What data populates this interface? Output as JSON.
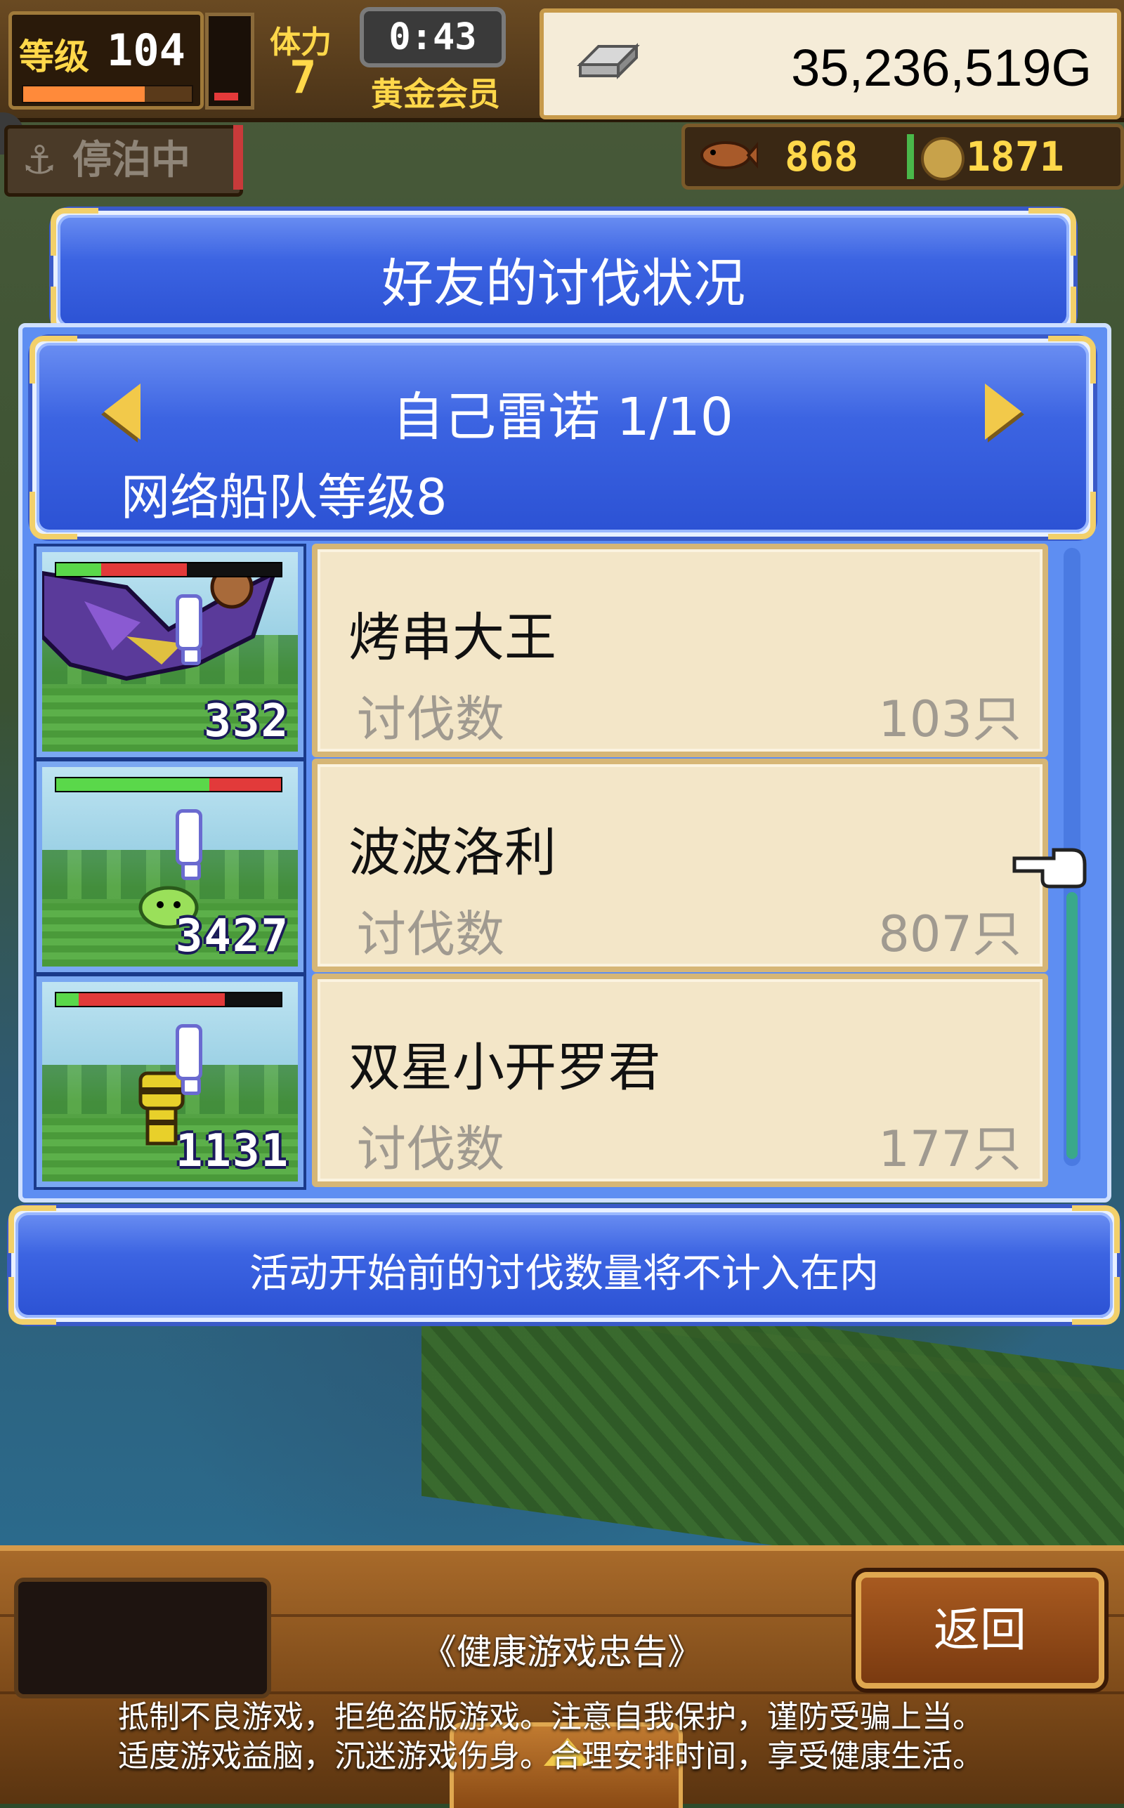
{
  "hud": {
    "level_label": "等级",
    "level_value": "104",
    "level_progress": 0.72,
    "stamina_gauge": 0.1,
    "stamina_label": "体力",
    "stamina_value": "7",
    "timer": "0:43",
    "membership": "黄金会员",
    "money": "35,236,519G",
    "dock_status": "停泊中",
    "resource1": "868",
    "resource2": "1871"
  },
  "dialog": {
    "title": "好友的讨伐状况",
    "page_name": "自己雷诺 1/10",
    "fleet_level": "网络船队等级8",
    "notice": "活动开始前的讨伐数量将不计入在内"
  },
  "list": {
    "kill_label": "讨伐数",
    "rows": [
      {
        "name": "烤串大王",
        "count_value": "103只",
        "thumb_count": "332",
        "hp_green": 0.2,
        "hp_red": 0.38
      },
      {
        "name": "波波洛利",
        "count_value": "807只",
        "thumb_count": "3427",
        "hp_green": 0.68,
        "hp_red": 0.32
      },
      {
        "name": "双星小开罗君",
        "count_value": "177只",
        "thumb_count": "1131",
        "hp_green": 0.1,
        "hp_red": 0.65
      }
    ]
  },
  "footer": {
    "back_button": "返回",
    "health_title": "《健康游戏忠告》",
    "health_line1": "抵制不良游戏，拒绝盗版游戏。注意自我保护，谨防受骗上当。",
    "health_line2": "适度游戏益脑，沉迷游戏伤身。合理安排时间，享受健康生活。"
  },
  "colors": {
    "panel_blue": "#3c64e2",
    "card_bg": "#f3e6c8",
    "gold": "#ffd84a"
  }
}
